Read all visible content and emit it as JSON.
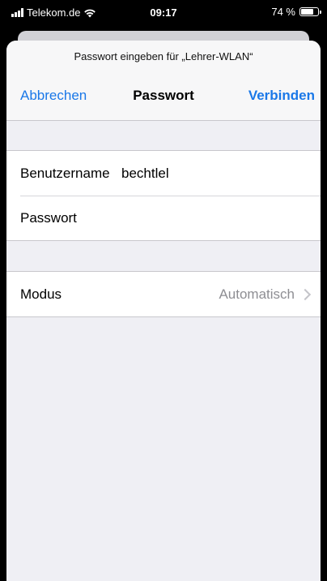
{
  "status_bar": {
    "carrier": "Telekom.de",
    "time": "09:17",
    "battery": "74 %",
    "battery_level_percent": 74,
    "icons": [
      "signal-icon",
      "wifi-icon",
      "battery-icon"
    ]
  },
  "sheet": {
    "prompt": "Passwort eingeben für „Lehrer-WLAN“",
    "cancel_label": "Abbrechen",
    "title": "Passwort",
    "connect_label": "Verbinden"
  },
  "credentials": {
    "username_label": "Benutzername",
    "username_value": "bechtlel",
    "password_label": "Passwort",
    "password_value": ""
  },
  "mode": {
    "label": "Modus",
    "value": "Automatisch"
  },
  "colors": {
    "accent": "#1a78e8",
    "background": "#efeff4",
    "secondary_text": "#8e8e93"
  }
}
